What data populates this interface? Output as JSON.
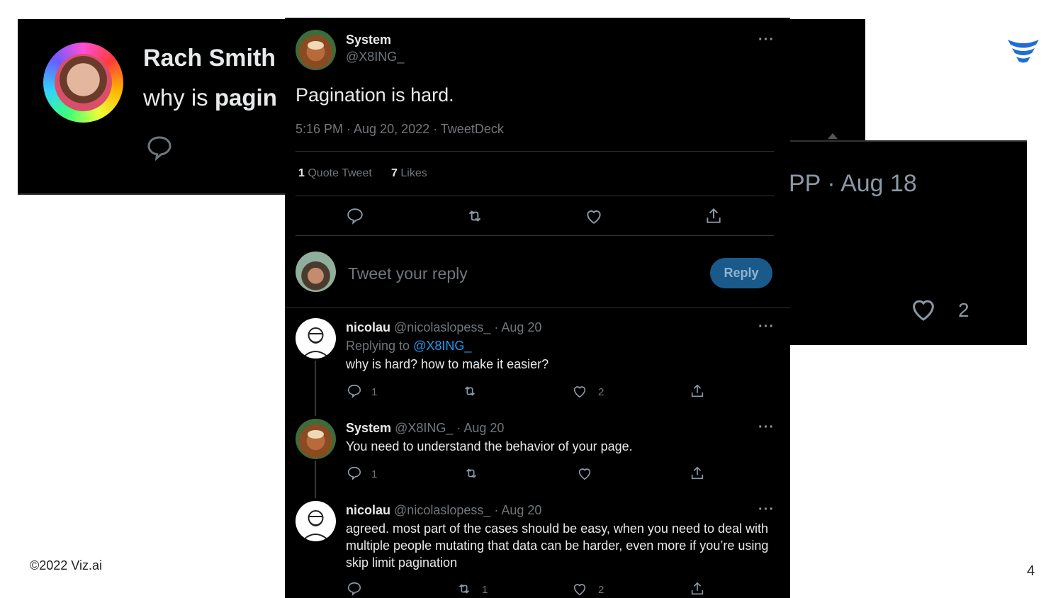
{
  "bg_left": {
    "name": "Rach Smith",
    "text_prefix": "why is ",
    "text_bold": "pagin"
  },
  "bg_right": {
    "date": "PP · Aug 18",
    "like_count": "2"
  },
  "tweet": {
    "author_name": "System",
    "author_handle": "@X8ING_",
    "text": "Pagination is hard.",
    "meta": "5:16 PM · Aug 20, 2022 · TweetDeck",
    "quote_count": "1",
    "quote_label": "Quote Tweet",
    "like_count": "7",
    "like_label": "Likes",
    "reply_placeholder": "Tweet your reply",
    "reply_button": "Reply"
  },
  "replies": [
    {
      "name": "nicolau",
      "handle_date": "@nicolaslopess_ · Aug 20",
      "replying_prefix": "Replying to",
      "replying_to": "@X8ING_",
      "text": "why is hard? how to make it easier?",
      "reply_count": "1",
      "retweet_count": "",
      "like_count": "2"
    },
    {
      "name": "System",
      "handle_date": "@X8ING_ · Aug 20",
      "text": "You need to understand the behavior of your page.",
      "reply_count": "1",
      "retweet_count": "",
      "like_count": ""
    },
    {
      "name": "nicolau",
      "handle_date": "@nicolaslopess_ · Aug 20",
      "text_lines": [
        "agreed. most part of the cases should be easy, when you need to deal with",
        "multiple people mutating that data can be harder, even more if you’re using",
        "skip limit pagination"
      ],
      "reply_count": "",
      "retweet_count": "1",
      "like_count": "2"
    }
  ],
  "more_glyph": "···",
  "footer": {
    "copyright": "©2022 Viz.ai",
    "page_number": "4"
  },
  "colors": {
    "panel_bg": "#000000",
    "text": "#e7e9ea",
    "muted": "#71767b",
    "link": "#1d9bf0",
    "reply_button": "#1a5a8a",
    "logo_blue": "#1f6fd1"
  },
  "icons": [
    "comment-icon",
    "retweet-icon",
    "heart-icon",
    "share-icon",
    "more-icon",
    "vizai-logo-icon"
  ]
}
